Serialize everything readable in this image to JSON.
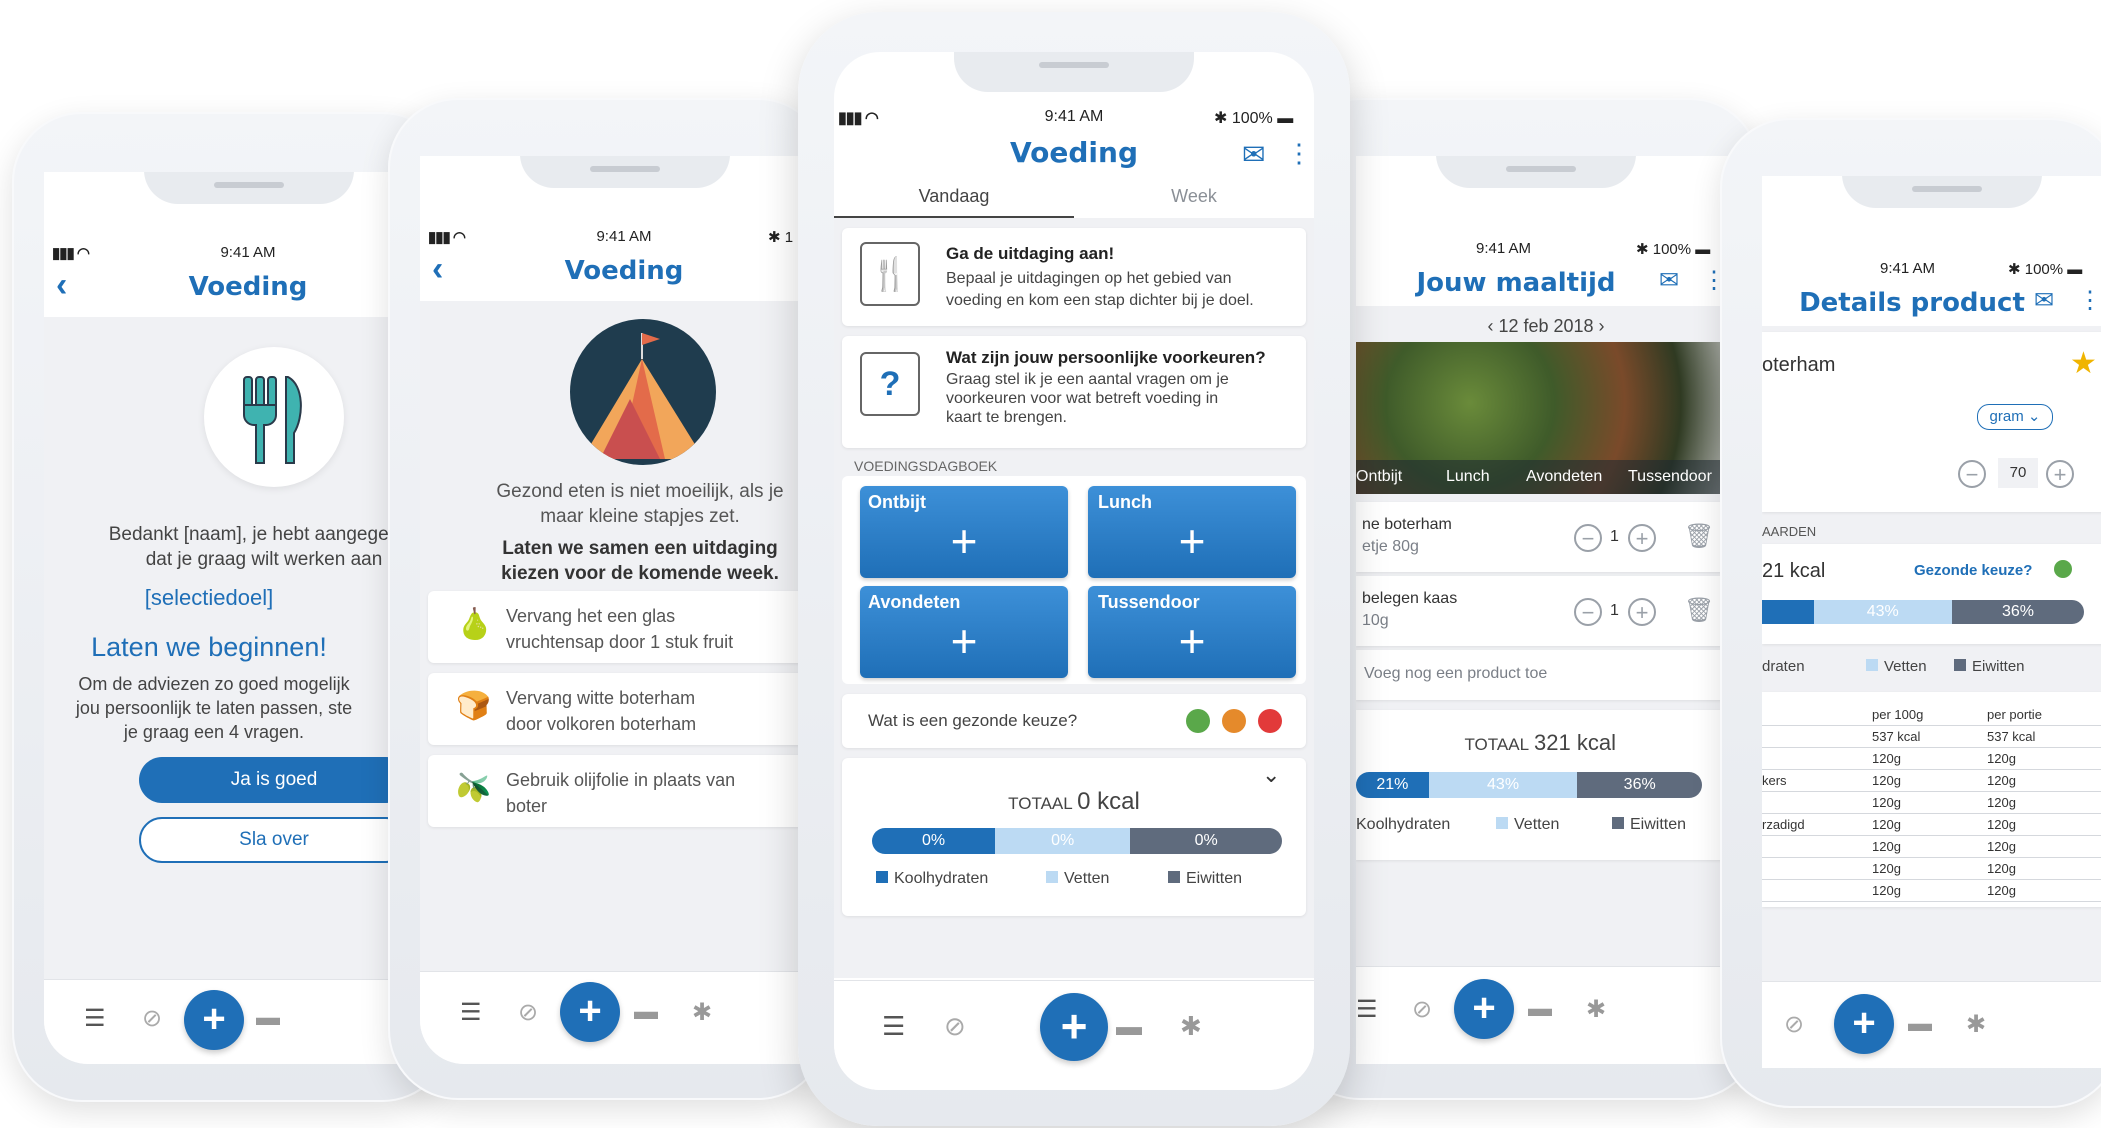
{
  "status": {
    "time": "9:41 AM",
    "battery": "100%"
  },
  "screen1": {
    "title": "Voeding",
    "thanks": "Bedankt [naam], je hebt aangegeven",
    "thanks2": "dat je graag wilt werken aan",
    "goal": "[selectiedoel]",
    "start": "Laten we beginnen!",
    "desc1": "Om de adviezen zo goed mogelijk",
    "desc2": "jou persoonlijk te laten passen, ste",
    "desc3": "je graag een 4 vragen.",
    "yes_button": "Ja is goed",
    "skip_button": "Sla over"
  },
  "screen2": {
    "title": "Voeding",
    "intro1": "Gezond eten is niet moeilijk, als je",
    "intro2": "maar kleine stapjes zet.",
    "bold1": "Laten we samen een uitdaging",
    "bold2": "kiezen voor de komende week.",
    "challenges": [
      {
        "line1": "Vervang het een glas",
        "line2": "vruchtensap door 1 stuk fruit",
        "icon": "pear-icon"
      },
      {
        "line1": "Vervang witte boterham",
        "line2": "door volkoren boterham",
        "icon": "bread-icon"
      },
      {
        "line1": "Gebruik olijfolie in plaats van",
        "line2": "boter",
        "icon": "olive-icon"
      }
    ]
  },
  "screen3": {
    "title": "Voeding",
    "tabs": [
      "Vandaag",
      "Week"
    ],
    "card1": {
      "title": "Ga de uitdaging aan!",
      "line1": "Bepaal je uitdagingen op het gebied van",
      "line2": "voeding en kom een stap dichter bij je doel."
    },
    "card2": {
      "title": "Wat zijn jouw persoonlijke voorkeuren?",
      "line1": "Graag stel ik je een aantal vragen om je",
      "line2": "voorkeuren voor wat betreft voeding in",
      "line3": "kaart te brengen."
    },
    "section": "VOEDINGSDAGBOEK",
    "meals": [
      "Ontbijt",
      "Lunch",
      "Avondeten",
      "Tussendoor"
    ],
    "healthy_question": "Wat is een gezonde keuze?",
    "dot_colors": [
      "#5aa84a",
      "#e58a2b",
      "#e23a3a"
    ],
    "total_label": "TOTAAL",
    "total_value": "0 kcal",
    "bar": [
      "0%",
      "0%",
      "0%"
    ],
    "legend": [
      "Koolhydraten",
      "Vetten",
      "Eiwitten"
    ]
  },
  "screen4": {
    "title": "Jouw maaltijd",
    "date": "12 feb 2018",
    "meal_tabs": [
      "Ontbijt",
      "Lunch",
      "Avondeten",
      "Tussendoor"
    ],
    "items": [
      {
        "name": "ne boterham",
        "sub": "etje 80g",
        "qty": "1"
      },
      {
        "name": "belegen kaas",
        "sub": "10g",
        "qty": "1"
      }
    ],
    "add_product": "Voeg nog een product toe",
    "total_label": "TOTAAL",
    "total_value": "321 kcal",
    "bar": [
      "21%",
      "43%",
      "36%"
    ],
    "legend": [
      "Koolhydraten",
      "Vetten",
      "Eiwitten"
    ]
  },
  "screen5": {
    "title": "Details product",
    "product": "oterham",
    "unit": "gram",
    "amount": "70",
    "section": "AARDEN",
    "kcal": "21 kcal",
    "healthy_q": "Gezonde keuze?",
    "bar": [
      "",
      "43%",
      "36%"
    ],
    "legend": [
      "draten",
      "Vetten",
      "Eiwitten"
    ],
    "table_header": [
      "per 100g",
      "per portie"
    ],
    "table_rows": [
      {
        "label": "",
        "a": "537 kcal",
        "b": "537 kcal"
      },
      {
        "label": "",
        "a": "120g",
        "b": "120g"
      },
      {
        "label": "kers",
        "a": "120g",
        "b": "120g"
      },
      {
        "label": "",
        "a": "120g",
        "b": "120g"
      },
      {
        "label": "rzadigd",
        "a": "120g",
        "b": "120g"
      },
      {
        "label": "",
        "a": "120g",
        "b": "120g"
      },
      {
        "label": "",
        "a": "120g",
        "b": "120g"
      },
      {
        "label": "",
        "a": "120g",
        "b": "120g"
      }
    ]
  }
}
